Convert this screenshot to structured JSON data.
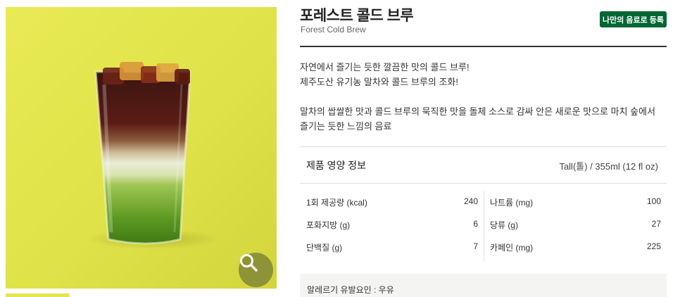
{
  "product": {
    "name_ko": "포레스트 콜드 브루",
    "name_en": "Forest Cold Brew",
    "register_button": "나만의 음료로 등록"
  },
  "description": {
    "line1": "자연에서 즐기는 듯한 깔끔한 맛의 콜드 브루!",
    "line2": "제주도산 유기농 말차와 콜드 브루의 조화!",
    "line3": "말차의 쌉쌀한 맛과 콜드 브루의 묵직한 맛을 돌체 소스로 감싸 안은 새로운 맛으로 마치 숲에서",
    "line4": "즐기는 듯한 느낌의 음료"
  },
  "nutrition": {
    "title": "제품 영양 정보",
    "serving": "Tall(톨) / 355ml (12 fl oz)",
    "left": [
      {
        "label": "1회 제공량 (kcal)",
        "value": "240"
      },
      {
        "label": "포화지방 (g)",
        "value": "6"
      },
      {
        "label": "단백질 (g)",
        "value": "7"
      }
    ],
    "right": [
      {
        "label": "나트륨 (mg)",
        "value": "100"
      },
      {
        "label": "당류 (g)",
        "value": "27"
      },
      {
        "label": "카페인 (mg)",
        "value": "225"
      }
    ]
  },
  "allergy": "알레르기 유발요인 : 우유",
  "icons": {
    "zoom": "magnifier-icon"
  },
  "colors": {
    "brand_green": "#006633",
    "photo_bg": "#e4e554",
    "zoom_button": "#8d9336"
  }
}
